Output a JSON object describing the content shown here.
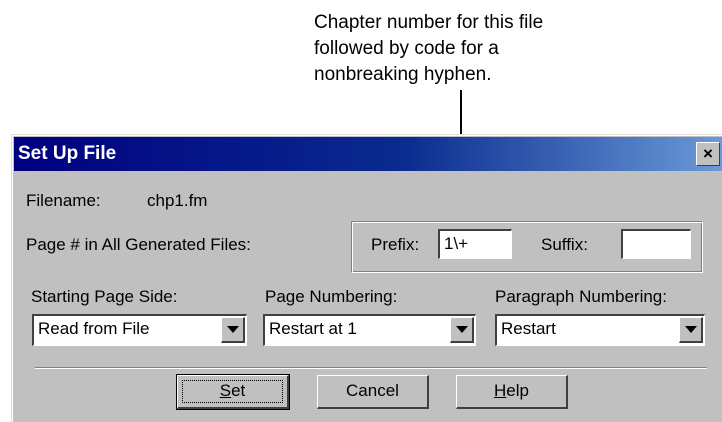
{
  "callout": {
    "lines": [
      "Chapter number for this file",
      "followed by code for a",
      "nonbreaking hyphen."
    ]
  },
  "dialog": {
    "title": "Set Up File",
    "close_glyph": "×",
    "filename_label": "Filename:",
    "filename_value": "chp1.fm",
    "page_num_label": "Page # in All Generated Files:",
    "prefix_label": "Prefix:",
    "prefix_value": "1\\+",
    "suffix_label": "Suffix:",
    "suffix_value": "",
    "starting_side": {
      "label": "Starting Page Side:",
      "selected": "Read from File"
    },
    "page_numbering": {
      "label": "Page Numbering:",
      "selected": "Restart at 1"
    },
    "para_numbering": {
      "label": "Paragraph Numbering:",
      "selected": "Restart"
    },
    "buttons": {
      "set": {
        "accel": "S",
        "rest": "et"
      },
      "cancel": "Cancel",
      "help": {
        "accel": "H",
        "rest": "elp"
      }
    }
  },
  "icons": {
    "close": "close-icon",
    "dropdown": "chevron-down-icon"
  },
  "colors": {
    "titlebar_start": "#000080",
    "titlebar_end": "#6a9ad8",
    "face": "#c0c0c0"
  }
}
